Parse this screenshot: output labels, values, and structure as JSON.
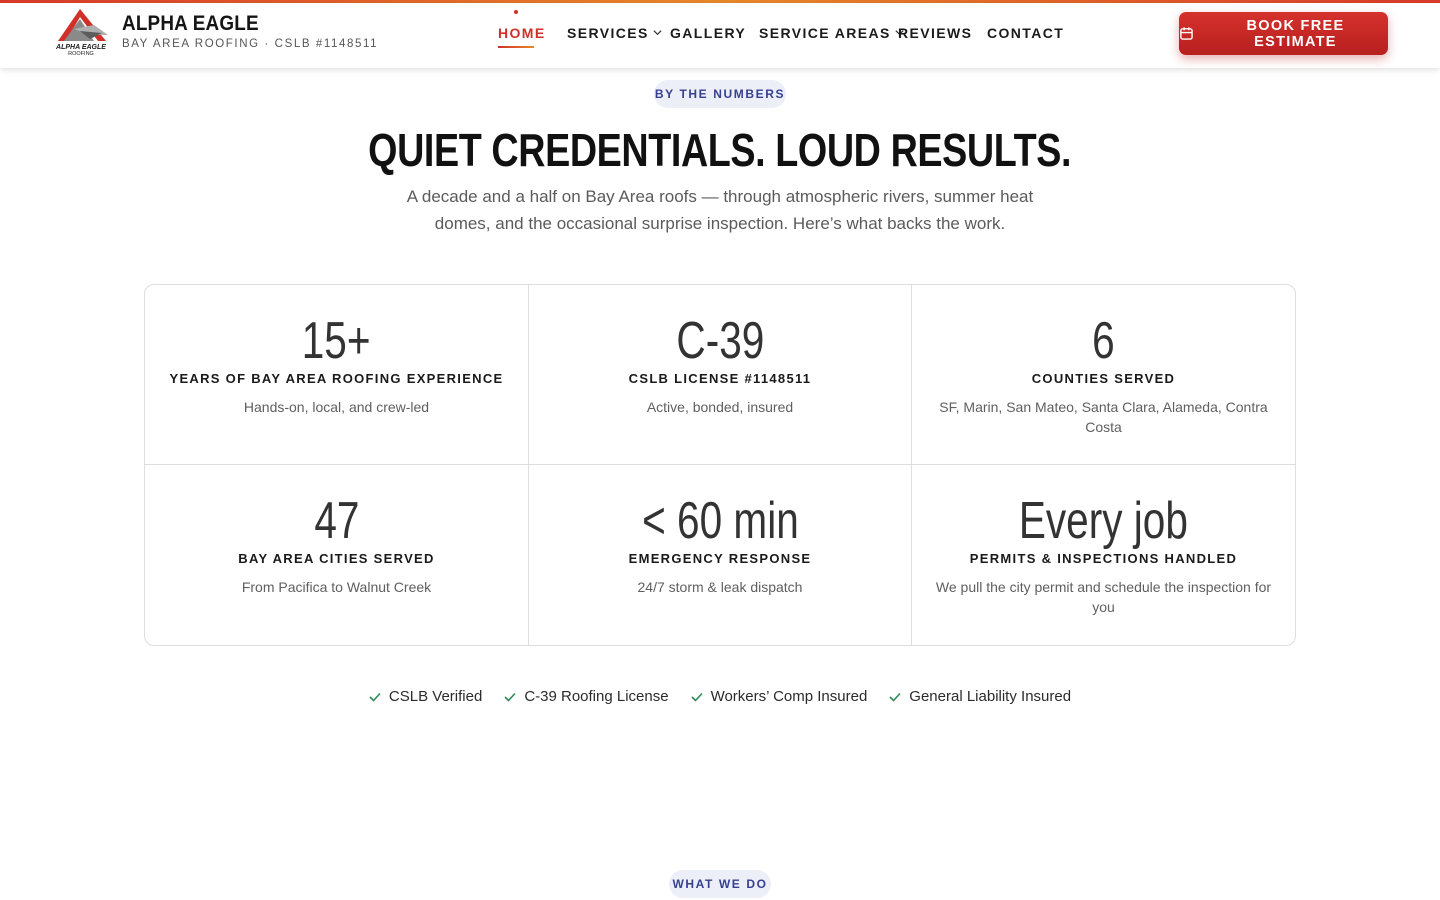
{
  "brand": {
    "name": "ALPHA EAGLE",
    "subtitle": "BAY AREA ROOFING · CSLB #1148511",
    "logo_text_1": "ALPHA EAGLE",
    "logo_text_2": "ROOFING"
  },
  "nav": {
    "items": [
      {
        "label": "HOME",
        "active": true
      },
      {
        "label": "SERVICES",
        "dropdown": true
      },
      {
        "label": "GALLERY"
      },
      {
        "label": "SERVICE AREAS",
        "dropdown": true
      },
      {
        "label": "REVIEWS"
      },
      {
        "label": "CONTACT"
      }
    ],
    "cta_label": "BOOK FREE ESTIMATE",
    "cta_icon": "calendar-icon"
  },
  "numbers_section": {
    "eyebrow": "BY THE NUMBERS",
    "title": "QUIET CREDENTIALS. LOUD RESULTS.",
    "intro": "A decade and a half on Bay Area roofs — through atmospheric rivers, summer heat domes, and the occasional surprise inspection. Here’s what backs the work.",
    "stats": [
      {
        "value": "15+",
        "label": "YEARS OF BAY AREA ROOFING EXPERIENCE",
        "desc": "Hands-on, local, and crew-led"
      },
      {
        "value": "C-39",
        "label": "CSLB LICENSE #1148511",
        "desc": "Active, bonded, insured"
      },
      {
        "value": "6",
        "label": "COUNTIES SERVED",
        "desc": "SF, Marin, San Mateo, Santa Clara, Alameda, Contra Costa"
      },
      {
        "value": "47",
        "label": "BAY AREA CITIES SERVED",
        "desc": "From Pacifica to Walnut Creek"
      },
      {
        "value": "< 60 min",
        "label": "EMERGENCY RESPONSE",
        "desc": "24/7 storm & leak dispatch"
      },
      {
        "value": "Every job",
        "label": "PERMITS & INSPECTIONS HANDLED",
        "desc": "We pull the city permit and schedule the inspection for you"
      }
    ],
    "badges": [
      "CSLB Verified",
      "C-39 Roofing License",
      "Workers’ Comp Insured",
      "General Liability Insured"
    ]
  },
  "next_section": {
    "eyebrow": "WHAT WE DO"
  },
  "colors": {
    "accent": "#d0302a",
    "accent_secondary": "#e8892b",
    "pill_bg": "#eceef8",
    "pill_text": "#37418f",
    "check": "#2e8b57"
  }
}
